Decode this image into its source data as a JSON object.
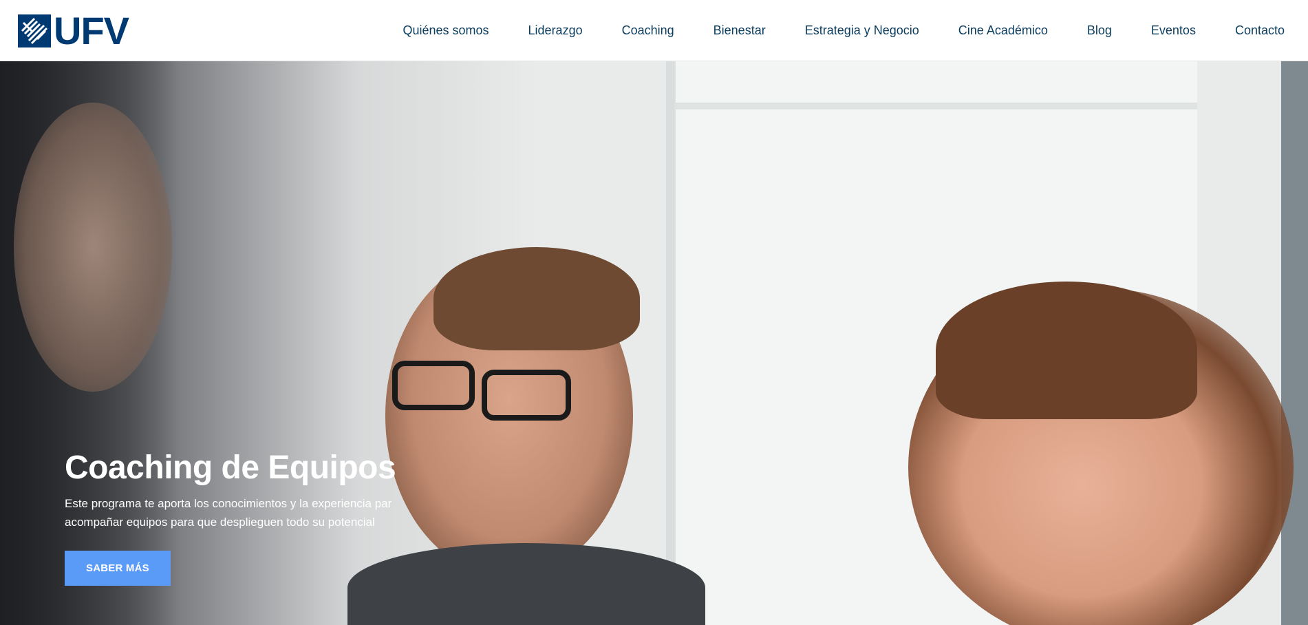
{
  "header": {
    "logo_text": "UFV",
    "brand_color": "#003a73",
    "nav": [
      {
        "label": "Quiénes somos"
      },
      {
        "label": "Liderazgo"
      },
      {
        "label": "Coaching"
      },
      {
        "label": "Bienestar"
      },
      {
        "label": "Estrategia y Negocio"
      },
      {
        "label": "Cine Académico"
      },
      {
        "label": "Blog"
      },
      {
        "label": "Eventos"
      },
      {
        "label": "Contacto"
      }
    ]
  },
  "hero": {
    "title": "Coaching de Equipos",
    "description": "Este programa te aporta los conocimientos y la experiencia par acompañar equipos para que desplieguen todo su potencial",
    "cta_label": "SABER MÁS",
    "cta_color": "#5b9bf8",
    "image": "photo-people-smiling-office"
  }
}
